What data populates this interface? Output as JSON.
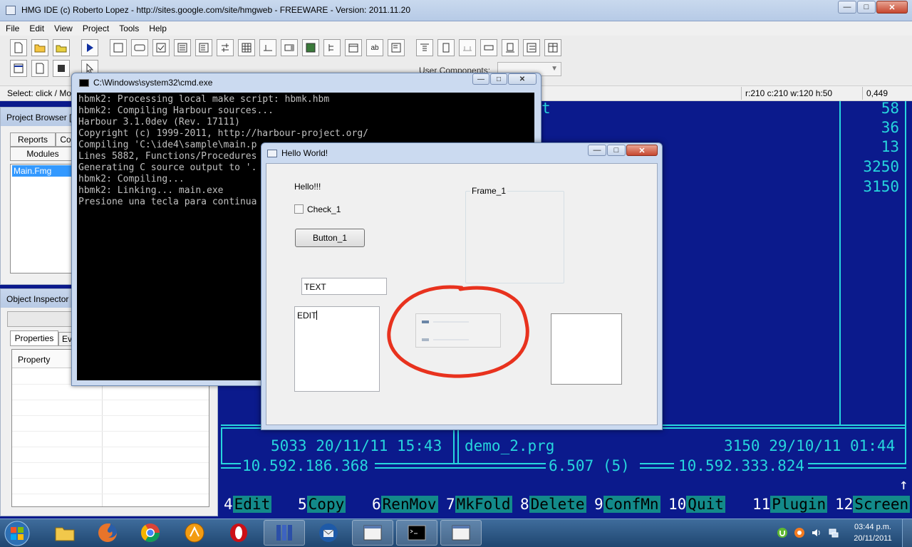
{
  "ide": {
    "title": "HMG IDE (c) Roberto Lopez - http://sites.google.com/site/hmgweb - FREEWARE - Version: 2011.11.20",
    "menu": [
      "File",
      "Edit",
      "View",
      "Project",
      "Tools",
      "Help"
    ],
    "user_components_label": "User Components:",
    "status": {
      "select": "Select: click / Mo",
      "coords": "r:210 c:210 w:120 h:50",
      "pos": "0,449"
    },
    "project_browser": {
      "title": "Project Browser [",
      "tabs": [
        "Reports",
        "Co"
      ],
      "modules_tab": "Modules",
      "items": [
        "Main.Fmg"
      ]
    },
    "object_inspector": {
      "title": "Object Inspector",
      "tabs": [
        "Properties",
        "Ev"
      ],
      "column": "Property"
    }
  },
  "console": {
    "right_numbers": [
      "58",
      "36",
      "13",
      "3250",
      "3150"
    ],
    "top_fragment": "t",
    "left_info": "5033 20/11/11 15:43",
    "right_file": "demo_2.prg",
    "right_info": "3150 29/10/11 01:44",
    "left_total": "10.592.186.368",
    "center_total": "6.507 (5)",
    "right_total": "10.592.333.824",
    "up_arrow": "↑",
    "fkeys": [
      {
        "n": "4",
        "l": "Edit"
      },
      {
        "n": "5",
        "l": "Copy"
      },
      {
        "n": "6",
        "l": "RenMov"
      },
      {
        "n": "7",
        "l": "MkFold"
      },
      {
        "n": "8",
        "l": "Delete"
      },
      {
        "n": "9",
        "l": "ConfMn"
      },
      {
        "n": "10",
        "l": "Quit"
      },
      {
        "n": "11",
        "l": "Plugin"
      },
      {
        "n": "12",
        "l": "Screen"
      }
    ]
  },
  "cmd": {
    "title": "C:\\Windows\\system32\\cmd.exe",
    "lines": [
      "hbmk2: Processing local make script: hbmk.hbm",
      "hbmk2: Compiling Harbour sources...",
      "Harbour 3.1.0dev (Rev. 17111)",
      "Copyright (c) 1999-2011, http://harbour-project.org/",
      "Compiling 'C:\\ide4\\sample\\main.p",
      "Lines 5882, Functions/Procedures",
      "Generating C source output to '.",
      "hbmk2: Compiling...",
      "hbmk2: Linking... main.exe",
      "Presione una tecla para continua"
    ]
  },
  "hello": {
    "title": "Hello World!",
    "label": "Hello!!!",
    "checkbox": "Check_1",
    "button": "Button_1",
    "frame": "Frame_1",
    "textbox": "TEXT",
    "editbox": "EDIT"
  },
  "taskbar": {
    "time": "03:44 p.m.",
    "date": "20/11/2011"
  },
  "colors": {
    "console_bg": "#0b1a8c",
    "console_fg": "#27d6dd",
    "fkey_bg": "#138a8a",
    "annotation_red": "#e8321e"
  }
}
